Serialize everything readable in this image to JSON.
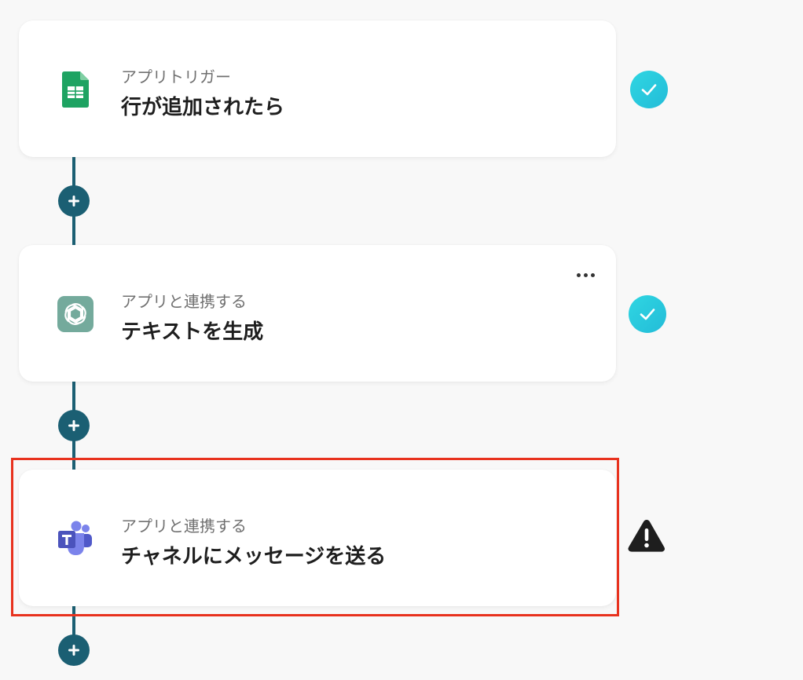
{
  "steps": [
    {
      "subtitle": "アプリトリガー",
      "title": "行が追加されたら",
      "app_icon": "google-sheets-icon",
      "status": "check-icon"
    },
    {
      "subtitle": "アプリと連携する",
      "title": "テキストを生成",
      "app_icon": "chatgpt-icon",
      "status": "check-icon"
    },
    {
      "subtitle": "アプリと連携する",
      "title": "チャネルにメッセージを送る",
      "app_icon": "microsoft-teams-icon",
      "status": "warning-icon"
    }
  ],
  "colors": {
    "connector": "#1b5f73",
    "status_ok": "#23c3dc",
    "status_warn": "#1e1e1e",
    "highlight": "#e8321e"
  }
}
